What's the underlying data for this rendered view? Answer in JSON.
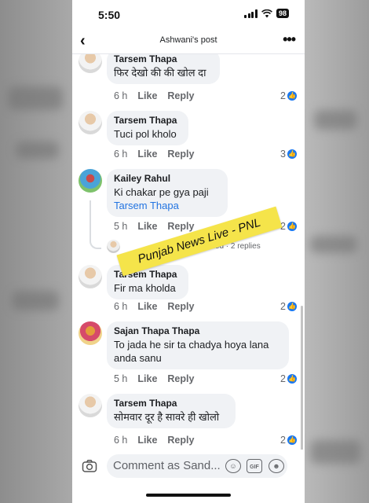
{
  "status_bar": {
    "time": "5:50",
    "battery": "98"
  },
  "header": {
    "title": "Ashwani's post"
  },
  "comments": [
    {
      "name": "Tarsem Thapa",
      "text": "फिर देखो की की खोल दा",
      "time": "6 h",
      "like": "Like",
      "reply": "Reply",
      "reactions": "2"
    },
    {
      "name": "Tarsem Thapa",
      "text": "Tuci pol kholo",
      "time": "6 h",
      "like": "Like",
      "reply": "Reply",
      "reactions": "3"
    },
    {
      "name": "Kailey Rahul",
      "text": "Ki chakar pe gya paji ",
      "mention": "Tarsem Thapa",
      "time": "5 h",
      "like": "Like",
      "reply": "Reply",
      "reactions": "2",
      "replies_summary": "replied · 2 replies"
    },
    {
      "name": "Tarsem Thapa",
      "text": "Fir ma kholda",
      "time": "6 h",
      "like": "Like",
      "reply": "Reply",
      "reactions": "2"
    },
    {
      "name": "Sajan Thapa Thapa",
      "text": "To jada he sir ta chadya hoya lana anda sanu",
      "time": "5 h",
      "like": "Like",
      "reply": "Reply",
      "reactions": "2"
    },
    {
      "name": "Tarsem Thapa",
      "text": "सोमवार दूर है सावरे ही खोलो",
      "time": "6 h",
      "like": "Like",
      "reply": "Reply",
      "reactions": "2"
    }
  ],
  "composer": {
    "placeholder": "Comment as Sand...",
    "gif": "GIF"
  },
  "watermark": "Punjab News Live - PNL",
  "colors": {
    "accent": "#1877f2",
    "watermark_bg": "#f5e44a"
  },
  "icons": [
    "back-icon",
    "more-icon",
    "like-reaction-icon",
    "camera-icon",
    "sticker-icon",
    "gif-icon",
    "emoji-icon"
  ]
}
